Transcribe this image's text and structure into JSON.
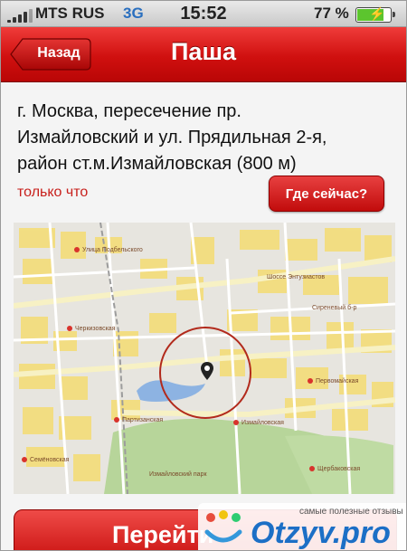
{
  "status_bar": {
    "carrier": "MTS RUS",
    "network": "3G",
    "time": "15:52",
    "battery_percent": "77 %",
    "battery_level": 0.77
  },
  "navbar": {
    "back_label": "Назад",
    "title": "Паша"
  },
  "location": {
    "address_lines": [
      "г. Москва, пересечение пр.",
      "Измайловский и ул. Прядильная 2-я,",
      "район ст.м.Измайловская (800 м)"
    ],
    "time_ago": "только что",
    "where_now_label": "Где сейчас?"
  },
  "map": {
    "labels": [
      "Улица Подбельского",
      "Черкизовская",
      "Семёновская",
      "Партизанская",
      "Измайловская",
      "Первомайская",
      "Щербаковская",
      "Шоссе Энтузиастов",
      "Измайловский парк",
      "Сиреневый б-р"
    ]
  },
  "bottom_button": {
    "label": "Перейти"
  },
  "watermark": {
    "slogan": "самые полезные отзывы",
    "brand": "Otzyv.pro"
  },
  "colors": {
    "accent": "#d0100f",
    "time_ago": "#c8201c",
    "map_yellow": "#f4dd78",
    "park_green": "#b7d59a"
  }
}
